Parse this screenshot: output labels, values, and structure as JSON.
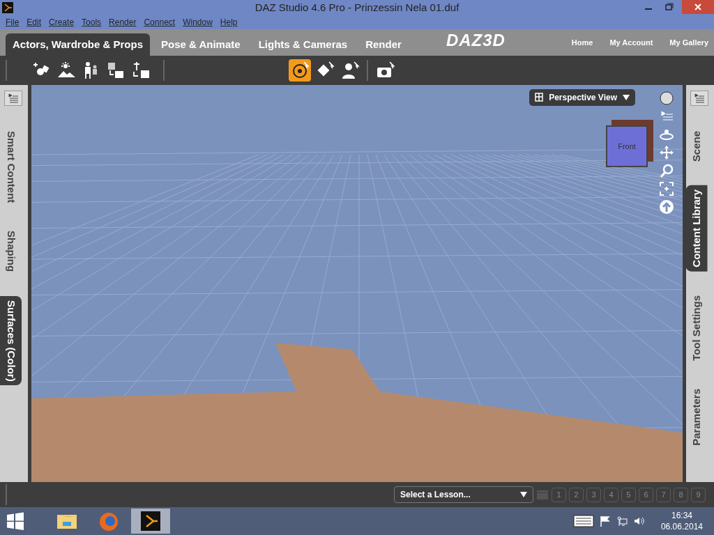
{
  "window": {
    "title": "DAZ Studio 4.6 Pro - Prinzessin Nela 01.duf"
  },
  "menu": [
    "File",
    "Edit",
    "Create",
    "Tools",
    "Render",
    "Connect",
    "Window",
    "Help"
  ],
  "workspace_tabs": [
    {
      "label": "Actors, Wardrobe & Props",
      "selected": true
    },
    {
      "label": "Pose & Animate",
      "selected": false
    },
    {
      "label": "Lights & Cameras",
      "selected": false
    },
    {
      "label": "Render",
      "selected": false
    }
  ],
  "logo": "DAZ3D",
  "header_links": [
    "Home",
    "My Account",
    "My Gallery"
  ],
  "toolbar": {
    "left_tools": [
      {
        "kind": "add-prop"
      },
      {
        "kind": "light-scene"
      },
      {
        "kind": "figures"
      },
      {
        "kind": "swap-item"
      },
      {
        "kind": "drop-item"
      }
    ],
    "center_tools": [
      {
        "kind": "orbit",
        "selected": true
      },
      {
        "kind": "transform",
        "selected": false
      },
      {
        "kind": "pose",
        "selected": false
      }
    ],
    "right_tools": [
      {
        "kind": "camera"
      }
    ]
  },
  "left_tabs": [
    {
      "label": "Smart Content",
      "selected": false
    },
    {
      "label": "Shaping",
      "selected": false
    },
    {
      "label": "Surfaces (Color)",
      "selected": true
    }
  ],
  "right_tabs": [
    {
      "label": "Scene",
      "selected": false
    },
    {
      "label": "Content Library",
      "selected": true
    },
    {
      "label": "Tool Settings",
      "selected": false
    },
    {
      "label": "Parameters",
      "selected": false
    }
  ],
  "viewport": {
    "view_select": "Perspective View",
    "cube_label": "Front"
  },
  "lesson_bar": {
    "select": "Select a Lesson...",
    "steps": [
      {
        "label": "1",
        "disabled": true
      },
      {
        "label": "2",
        "disabled": true
      },
      {
        "label": "3",
        "disabled": true
      },
      {
        "label": "4",
        "disabled": true
      },
      {
        "label": "5",
        "disabled": true
      },
      {
        "label": "6",
        "disabled": true
      },
      {
        "label": "7",
        "disabled": true
      },
      {
        "label": "8",
        "disabled": true
      },
      {
        "label": "9",
        "disabled": true
      }
    ]
  },
  "taskbar": {
    "apps": [
      {
        "kind": "explorer",
        "selected": false
      },
      {
        "kind": "browser",
        "selected": false
      },
      {
        "kind": "daz",
        "selected": true
      }
    ],
    "time": "16:34",
    "date": "06.06.2014"
  }
}
